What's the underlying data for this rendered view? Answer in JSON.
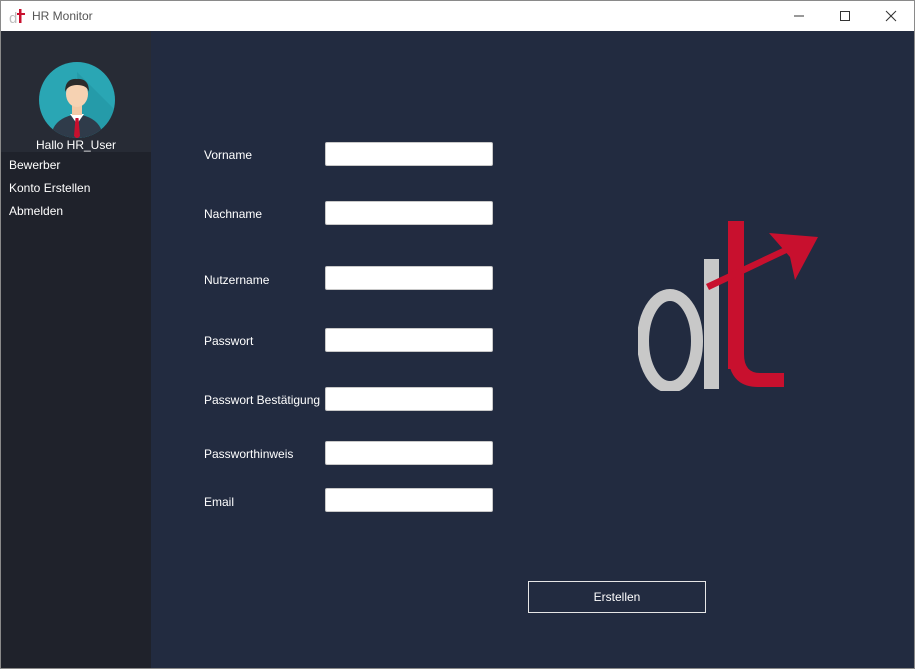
{
  "window": {
    "title": "HR Monitor",
    "controls": [
      "minimize",
      "maximize",
      "close"
    ]
  },
  "sidebar": {
    "greeting": "Hallo HR_User",
    "items": [
      {
        "label": "Bewerber"
      },
      {
        "label": "Konto Erstellen"
      },
      {
        "label": "Abmelden"
      }
    ]
  },
  "form": {
    "fields": [
      {
        "label": "Vorname",
        "value": "",
        "placeholder": ""
      },
      {
        "label": "Nachname",
        "value": "",
        "placeholder": ""
      },
      {
        "label": "Nutzername",
        "value": "",
        "placeholder": ""
      },
      {
        "label": "Passwort",
        "value": "",
        "placeholder": ""
      },
      {
        "label": "Passwort Bestätigung",
        "value": "",
        "placeholder": ""
      },
      {
        "label": "Passworthinweis",
        "value": "",
        "placeholder": ""
      },
      {
        "label": "Email",
        "value": "",
        "placeholder": ""
      }
    ],
    "submit_label": "Erstellen"
  },
  "colors": {
    "sidebar_bg": "#1f222b",
    "profile_bg": "#272b35",
    "main_bg": "#222b40",
    "logo_red": "#c8102e",
    "logo_gray": "#c8c8c8",
    "avatar_bg": "#2aa6b4"
  },
  "icons": {
    "app": "dt-logo-icon",
    "avatar": "user-avatar-icon",
    "minimize": "minimize-icon",
    "maximize": "maximize-icon",
    "close": "close-icon"
  }
}
